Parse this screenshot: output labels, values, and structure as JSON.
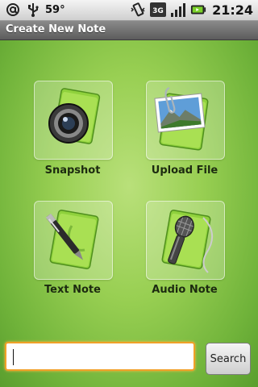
{
  "status_bar": {
    "temperature": "59°",
    "time": "21:24",
    "network_type": "3G",
    "icons": [
      "at-sign-icon",
      "usb-icon",
      "vibrate-icon",
      "signal-3g-icon",
      "signal-bars-icon",
      "battery-icon"
    ]
  },
  "title_bar": {
    "title": "Create New Note"
  },
  "grid": {
    "items": [
      {
        "label": "Snapshot",
        "icon": "camera-icon"
      },
      {
        "label": "Upload File",
        "icon": "photo-upload-icon"
      },
      {
        "label": "Text Note",
        "icon": "pen-icon"
      },
      {
        "label": "Audio Note",
        "icon": "microphone-icon"
      }
    ]
  },
  "search": {
    "value": "",
    "placeholder": "",
    "button_label": "Search"
  },
  "colors": {
    "accent_green": "#98cf52",
    "focus_orange": "#f0a028"
  }
}
